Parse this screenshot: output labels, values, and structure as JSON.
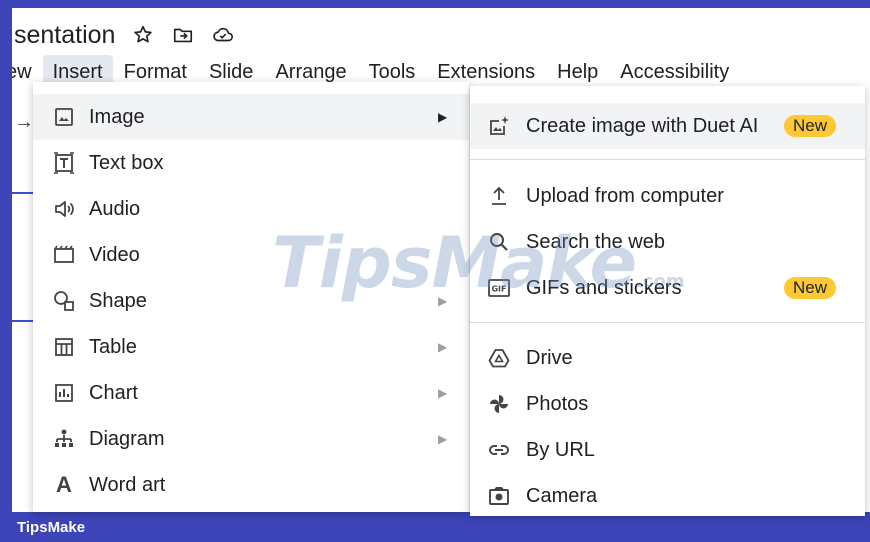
{
  "document": {
    "title": "sentation",
    "icons": [
      "star-icon",
      "folder-move-icon",
      "cloud-saved-icon"
    ]
  },
  "menubar": {
    "items": [
      "ew",
      "Insert",
      "Format",
      "Slide",
      "Arrange",
      "Tools",
      "Extensions",
      "Help",
      "Accessibility"
    ],
    "active": "Insert"
  },
  "insert_menu": {
    "items": [
      {
        "label": "Image",
        "icon": "image-icon",
        "submenu": true
      },
      {
        "label": "Text box",
        "icon": "text-box-icon",
        "submenu": false
      },
      {
        "label": "Audio",
        "icon": "audio-icon",
        "submenu": false
      },
      {
        "label": "Video",
        "icon": "video-icon",
        "submenu": false
      },
      {
        "label": "Shape",
        "icon": "shape-icon",
        "submenu": true
      },
      {
        "label": "Table",
        "icon": "table-icon",
        "submenu": true
      },
      {
        "label": "Chart",
        "icon": "chart-icon",
        "submenu": true
      },
      {
        "label": "Diagram",
        "icon": "diagram-icon",
        "submenu": true
      },
      {
        "label": "Word art",
        "icon": "word-art-icon",
        "submenu": false
      }
    ],
    "word_art_glyph": "A"
  },
  "image_submenu": {
    "items": [
      {
        "label": "Create image with Duet AI",
        "icon": "ai-image-icon",
        "badge": "New"
      },
      {
        "label": "Upload from computer",
        "icon": "upload-icon"
      },
      {
        "label": "Search the web",
        "icon": "search-icon"
      },
      {
        "label": "GIFs and stickers",
        "icon": "gif-icon",
        "badge": "New",
        "icon_text": "GIF"
      },
      {
        "label": "Drive",
        "icon": "drive-icon"
      },
      {
        "label": "Photos",
        "icon": "photos-icon"
      },
      {
        "label": "By URL",
        "icon": "link-icon"
      },
      {
        "label": "Camera",
        "icon": "camera-icon"
      }
    ]
  },
  "watermark": {
    "text": "TipsMake",
    "suffix": ".com"
  },
  "footer": {
    "text": "TipsMake"
  },
  "colors": {
    "frame": "#3d44b8",
    "badge": "#fcc934",
    "accent": "#3c4fcf"
  }
}
